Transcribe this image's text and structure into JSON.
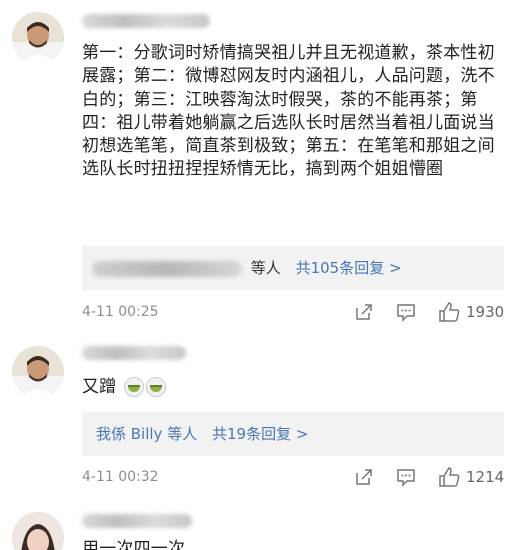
{
  "comments": [
    {
      "text": "第一：分歌词时矫情搞哭祖儿并且无视道歉，茶本性初展露；第二：微博怼网友时内涵祖儿，人品问题，洗不白的；第三：江映蓉淘汰时假哭，茶的不能再茶；第四：祖儿带着她躺赢之后选队长时居然当着祖儿面说当初想选笔笔，简直茶到极致；第五：在笔笔和那姐之间选队长时扭扭捏捏矫情无比，搞到两个姐姐懵圈",
      "reply_names_suffix": "等人",
      "reply_count": "共105条回复 >",
      "time": "4-11 00:25",
      "likes": "1930"
    },
    {
      "text": "又蹭",
      "reply_names": "我係 Billy 等人",
      "reply_count": "共19条回复 >",
      "time": "4-11 00:32",
      "likes": "1214"
    },
    {
      "text": "用一次四一次"
    }
  ],
  "icons": {
    "share": "share-icon",
    "comment": "comment-icon",
    "like": "thumbs-up-icon",
    "emoji": "tea-cup-emoji-icon"
  },
  "colors": {
    "link": "#4a77b4",
    "meta": "#8e8e8e",
    "reply_bg": "#f2f2f2",
    "text": "#222222"
  }
}
